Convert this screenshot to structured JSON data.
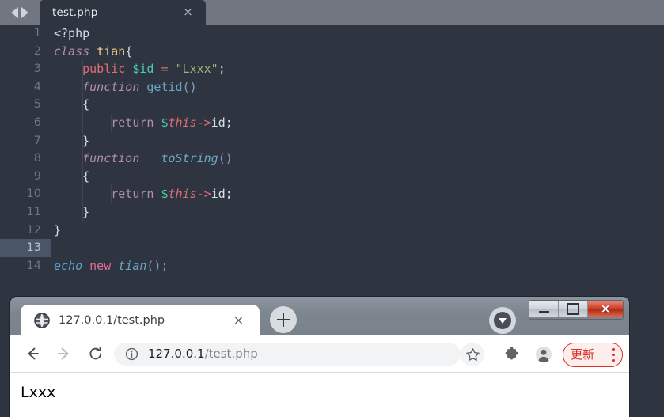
{
  "editor": {
    "nav": {
      "prev_icon": "triangle-left-icon",
      "next_icon": "triangle-right-icon"
    },
    "tab": {
      "label": "test.php",
      "close_icon": "×"
    },
    "lines": [
      {
        "num": "1",
        "active": false,
        "indent": 0
      },
      {
        "num": "2",
        "active": false,
        "indent": 0
      },
      {
        "num": "3",
        "active": false,
        "indent": 1
      },
      {
        "num": "4",
        "active": false,
        "indent": 1
      },
      {
        "num": "5",
        "active": false,
        "indent": 1
      },
      {
        "num": "6",
        "active": false,
        "indent": 2
      },
      {
        "num": "7",
        "active": false,
        "indent": 1
      },
      {
        "num": "8",
        "active": false,
        "indent": 1
      },
      {
        "num": "9",
        "active": false,
        "indent": 1
      },
      {
        "num": "10",
        "active": false,
        "indent": 2
      },
      {
        "num": "11",
        "active": false,
        "indent": 1
      },
      {
        "num": "12",
        "active": false,
        "indent": 0
      },
      {
        "num": "13",
        "active": true,
        "indent": 0
      },
      {
        "num": "14",
        "active": false,
        "indent": 0
      }
    ],
    "code": {
      "l1": "<?php",
      "l2_class": "class",
      "l2_name": "tian",
      "l2_brace": "{",
      "l3_public": "public",
      "l3_var": "$id",
      "l3_eq": "=",
      "l3_str": "\"Lxxx\"",
      "l3_semi": ";",
      "l4_function": "function",
      "l4_name": "getid",
      "l4_paren": "()",
      "l5": "{",
      "l6_return": "return",
      "l6_sigil": "$",
      "l6_this": "this",
      "l6_arrow": "->",
      "l6_prop": "id;",
      "l7": "}",
      "l8_function": "function",
      "l8_name": "__toString",
      "l8_paren": "()",
      "l9": "{",
      "l10_return": "return",
      "l10_sigil": "$",
      "l10_this": "this",
      "l10_arrow": "->",
      "l10_prop": "id;",
      "l11": "}",
      "l12": "}",
      "l13": "",
      "l14_echo": "echo",
      "l14_new": "new",
      "l14_name": "tian",
      "l14_paren": "();"
    }
  },
  "browser": {
    "window_controls": {
      "minimize_icon": "minimize-icon",
      "maximize_icon": "maximize-icon",
      "close_icon": "×"
    },
    "tab": {
      "favicon": "globe-icon",
      "title": "127.0.0.1/test.php",
      "close_icon": "×"
    },
    "new_tab_icon": "plus-icon",
    "tab_search_icon": "caret-down-circle-icon",
    "toolbar": {
      "back_icon": "arrow-left-icon",
      "forward_icon": "arrow-right-icon",
      "reload_icon": "reload-icon",
      "info_icon": "info-circle-icon",
      "url_host": "127.0.0.1",
      "url_path": "/test.php",
      "star_icon": "star-icon",
      "extensions_icon": "puzzle-piece-icon",
      "profile_icon": "person-icon",
      "update_label": "更新",
      "update_menu_icon": "three-dots-icon"
    },
    "page": {
      "body_text": "Lxxx"
    }
  },
  "colors": {
    "editor_bg": "#2e3440",
    "tabbar_bg": "#717681",
    "active_line": "#4a5565",
    "update_accent": "#d93025",
    "close_button": "#cf3a22"
  }
}
